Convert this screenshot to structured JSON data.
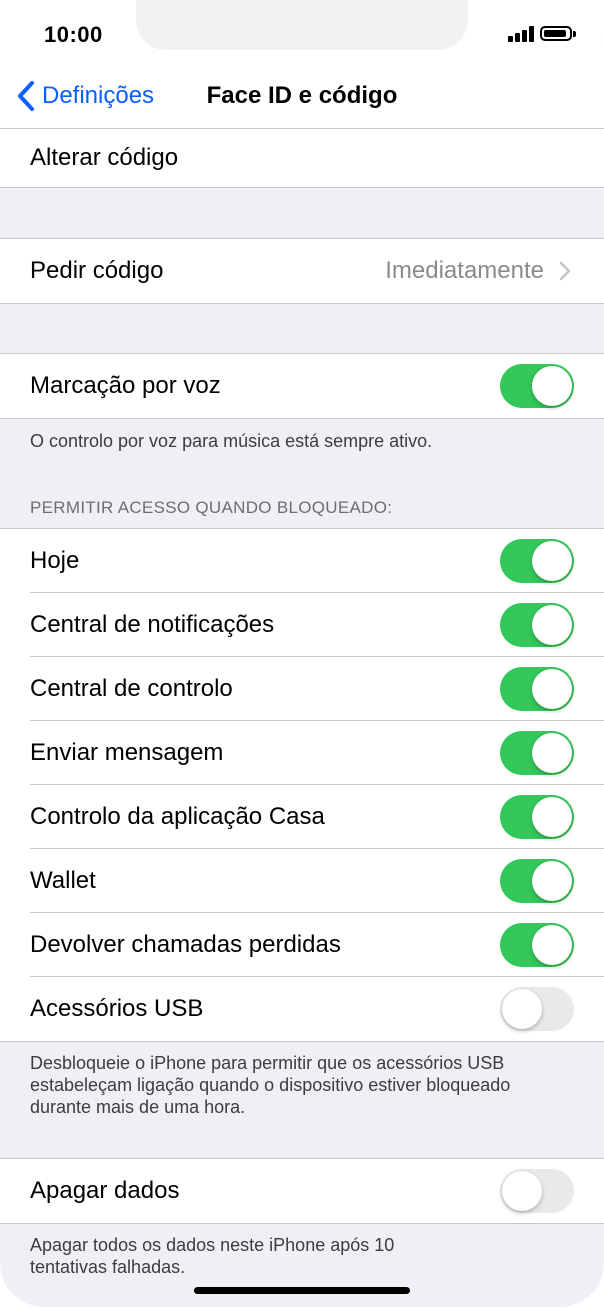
{
  "status": {
    "time": "10:00"
  },
  "nav": {
    "back_label": "Definições",
    "title": "Face ID e código"
  },
  "change_code": {
    "label": "Alterar código"
  },
  "require_code": {
    "label": "Pedir código",
    "value": "Imediatamente"
  },
  "voice_dial": {
    "label": "Marcação por voz",
    "on": true,
    "footer": "O controlo por voz para música está sempre ativo."
  },
  "locked_access": {
    "header": "PERMITIR ACESSO QUANDO BLOQUEADO:",
    "items": [
      {
        "label": "Hoje",
        "on": true
      },
      {
        "label": "Central de notificações",
        "on": true
      },
      {
        "label": "Central de controlo",
        "on": true
      },
      {
        "label": "Enviar mensagem",
        "on": true
      },
      {
        "label": "Controlo da aplicação Casa",
        "on": true
      },
      {
        "label": "Wallet",
        "on": true
      },
      {
        "label": "Devolver chamadas perdidas",
        "on": true
      },
      {
        "label": "Acessórios USB",
        "on": false
      }
    ],
    "footer_lines": [
      "Desbloqueie o iPhone para permitir que os acessórios USB",
      "estabeleçam ligação quando o dispositivo estiver bloqueado",
      "durante mais de uma hora."
    ]
  },
  "erase": {
    "label": "Apagar dados",
    "on": false,
    "footer_lines": [
      "Apagar todos os dados neste iPhone após 10",
      "tentativas falhadas."
    ]
  },
  "colors": {
    "accent": "#0a60ff",
    "toggle_on": "#34c759",
    "toggle_off": "#e9e9ea",
    "background": "#efeff4"
  }
}
